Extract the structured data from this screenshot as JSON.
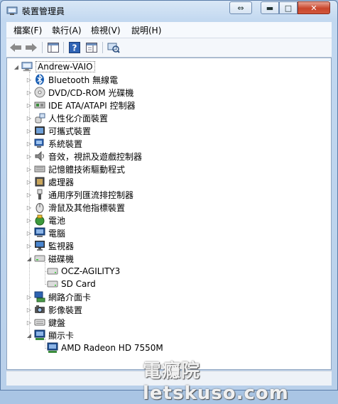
{
  "window": {
    "title": "裝置管理員",
    "controls": {
      "move": "⇔",
      "minimize": "▬",
      "maximize": "□",
      "close": "✕"
    }
  },
  "menu": [
    "檔案(F)",
    "執行(A)",
    "檢視(V)",
    "說明(H)"
  ],
  "tree": {
    "root": "Andrew-VAIO",
    "categories": [
      {
        "label": "Bluetooth 無線電",
        "icon": "bluetooth-icon"
      },
      {
        "label": "DVD/CD-ROM 光碟機",
        "icon": "dvd-drive-icon"
      },
      {
        "label": "IDE ATA/ATAPI 控制器",
        "icon": "ide-controller-icon"
      },
      {
        "label": "人性化介面裝置",
        "icon": "hid-icon"
      },
      {
        "label": "可攜式裝置",
        "icon": "portable-device-icon"
      },
      {
        "label": "系統裝置",
        "icon": "system-device-icon"
      },
      {
        "label": "音效，視訊及遊戲控制器",
        "icon": "sound-icon"
      },
      {
        "label": "記憶體技術驅動程式",
        "icon": "memory-tech-icon"
      },
      {
        "label": "處理器",
        "icon": "processor-icon"
      },
      {
        "label": "通用序列匯流排控制器",
        "icon": "usb-icon"
      },
      {
        "label": "滑鼠及其他指標裝置",
        "icon": "mouse-icon"
      },
      {
        "label": "電池",
        "icon": "battery-icon"
      },
      {
        "label": "電腦",
        "icon": "computer-icon"
      },
      {
        "label": "監視器",
        "icon": "monitor-icon"
      },
      {
        "label": "磁碟機",
        "icon": "disk-drive-icon",
        "children": [
          "OCZ-AGILITY3",
          "SD Card"
        ]
      },
      {
        "label": "網路介面卡",
        "icon": "network-adapter-icon"
      },
      {
        "label": "影像裝置",
        "icon": "imaging-device-icon"
      },
      {
        "label": "鍵盤",
        "icon": "keyboard-icon"
      },
      {
        "label": "顯示卡",
        "icon": "display-adapter-icon",
        "children": [
          "AMD Radeon HD 7550M"
        ]
      }
    ]
  },
  "watermark": "電癮院 letskuso.com"
}
